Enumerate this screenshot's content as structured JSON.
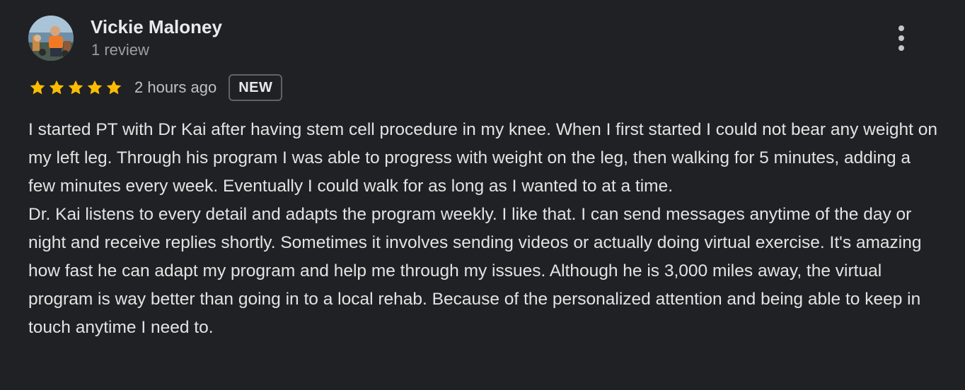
{
  "author": {
    "name": "Vickie Maloney",
    "meta": "1 review"
  },
  "review": {
    "rating": 5,
    "rating_max": 5,
    "star_color": "#fbbc04",
    "date": "2 hours ago",
    "badge": "NEW",
    "paragraphs": [
      "I started PT with Dr Kai after having stem cell procedure in my knee. When I first started I could not bear any weight on my left leg. Through his program I was able to progress with weight on the leg, then walking for 5 minutes, adding a few minutes every week. Eventually I could walk for as long as I wanted to at a time.",
      "Dr. Kai listens to every detail and adapts the program weekly. I like that. I can send messages anytime of the day or night and receive replies shortly. Sometimes it involves sending videos or actually doing virtual exercise. It's amazing how fast he can adapt my program and help me through my issues. Although he is 3,000 miles away, the virtual program is way better than going in to a local rehab. Because of the personalized attention and being able to keep in touch anytime I need to."
    ]
  },
  "icons": {
    "avatar": "user-photo-avatar",
    "more": "more-vert-icon",
    "star": "star-icon"
  }
}
